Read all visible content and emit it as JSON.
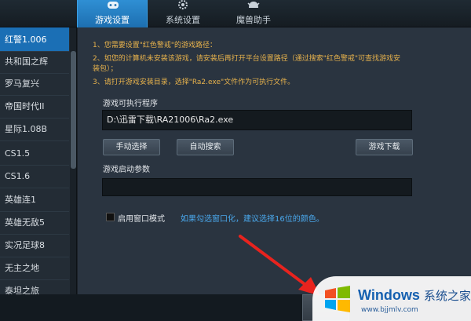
{
  "tabs": [
    {
      "label": "游戏设置",
      "icon": "gamepad-icon"
    },
    {
      "label": "系统设置",
      "icon": "gear-icon"
    },
    {
      "label": "魔兽助手",
      "icon": "helmet-icon"
    }
  ],
  "sidebar": {
    "items": [
      {
        "label": "红警1.006"
      },
      {
        "label": "共和国之辉"
      },
      {
        "label": "罗马复兴"
      },
      {
        "label": "帝国时代II"
      },
      {
        "label": "星际1.08B"
      },
      {
        "label": "CS1.5"
      },
      {
        "label": "CS1.6"
      },
      {
        "label": "英雄连1"
      },
      {
        "label": "英雄无敌5"
      },
      {
        "label": "实况足球8"
      },
      {
        "label": "无主之地"
      },
      {
        "label": "泰坦之旅"
      }
    ]
  },
  "instructions": {
    "line1": "1、您需要设置\"红色警戒\"的游戏路径：",
    "line2a": "2、如您的计算机未安装该游戏，请安装后再打开平台设置路径（通过搜索\"红色警戒\"可查找游戏安",
    "line2b": "装包）；",
    "line3": "3、请打开游戏安装目录，选择\"Ra2.exe\"文件作为可执行文件。"
  },
  "exe": {
    "label": "游戏可执行程序",
    "value": "D:\\迅雷下载\\RA21006\\Ra2.exe"
  },
  "buttons": {
    "manual": "手动选择",
    "auto": "自动搜索",
    "download": "游戏下载"
  },
  "params": {
    "label": "游戏启动参数",
    "value": ""
  },
  "window_mode": {
    "label": "启用窗口模式",
    "checked": false,
    "hint": "如果勾选窗口化，建议选择16位的颜色。"
  },
  "watermark": {
    "title": "Windows",
    "subtitle": "系统之家",
    "url": "www.bjjmlv.com"
  },
  "colors": {
    "accent": "#1d6fb0",
    "instruction_text": "#e7b24c",
    "hint_text": "#4aa8ec",
    "arrow": "#e8231e"
  }
}
